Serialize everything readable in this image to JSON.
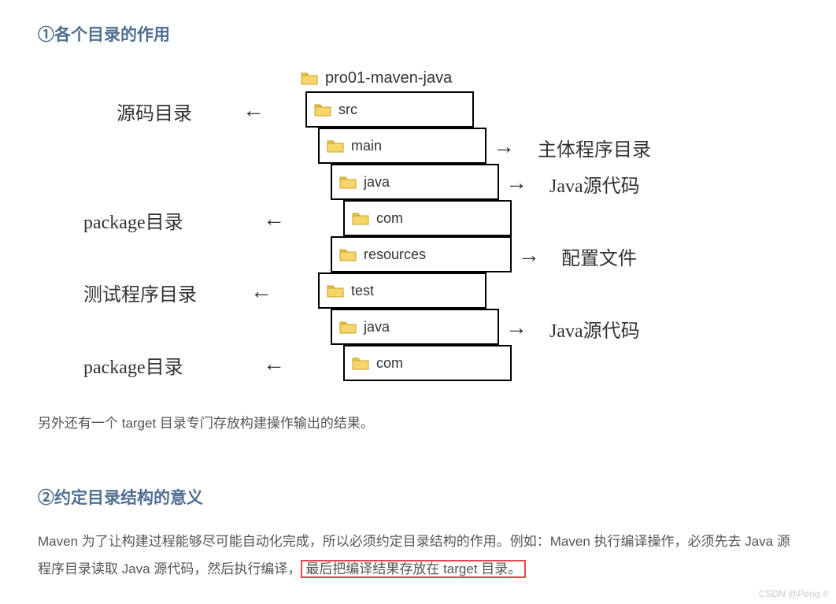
{
  "headings": {
    "h1": "①各个目录的作用",
    "h2": "②约定目录结构的意义"
  },
  "tree": {
    "root": "pro01-maven-java",
    "n1": "src",
    "n2": "main",
    "n3": "java",
    "n4": "com",
    "n5": "resources",
    "n6": "test",
    "n7": "java",
    "n8": "com"
  },
  "labels": {
    "l_src": "源码目录",
    "l_pkg": "package目录",
    "l_test": "测试程序目录",
    "l_pkg2": "package目录",
    "r_main": "主体程序目录",
    "r_java": "Java源代码",
    "r_res": "配置文件",
    "r_java2": "Java源代码"
  },
  "arrows": {
    "left": "←",
    "right": "→"
  },
  "paragraphs": {
    "p1": "另外还有一个 target 目录专门存放构建操作输出的结果。",
    "p2a": "Maven 为了让构建过程能够尽可能自动化完成，所以必须约定目录结构的作用。例如：Maven 执行编译操作，必须先去 Java 源程序目录读取 Java 源代码，然后执行编译，",
    "p2b": "最后把编译结果存放在 target 目录。"
  },
  "watermark": "CSDN @Peng-II"
}
